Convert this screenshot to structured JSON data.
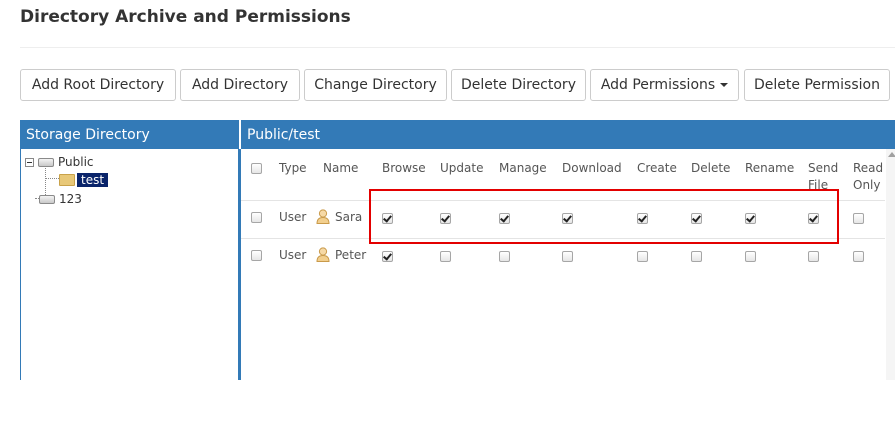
{
  "page": {
    "title": "Directory Archive and Permissions"
  },
  "toolbar": {
    "buttons": [
      {
        "label": "Add Root Directory"
      },
      {
        "label": "Add Directory"
      },
      {
        "label": "Change Directory"
      },
      {
        "label": "Delete Directory"
      },
      {
        "label": "Add Permissions",
        "has_caret": true
      },
      {
        "label": "Delete Permission"
      }
    ]
  },
  "storage": {
    "header": "Storage Directory",
    "tree": [
      {
        "label": "Public",
        "icon": "drive-icon",
        "expanded": true
      },
      {
        "label": "test",
        "icon": "folder-icon",
        "selected": true
      },
      {
        "label": "123",
        "icon": "drive-icon"
      }
    ]
  },
  "permissions": {
    "header": "Public/test",
    "columns": [
      "Type",
      "Name",
      "Browse",
      "Update",
      "Manage",
      "Download",
      "Create",
      "Delete",
      "Rename",
      "Send\nFile",
      "Read\nOnly"
    ],
    "rows": [
      {
        "type": "User",
        "name": "Sara",
        "icon": "user-icon",
        "flags": [
          true,
          true,
          true,
          true,
          true,
          true,
          true,
          true,
          false
        ]
      },
      {
        "type": "User",
        "name": "Peter",
        "icon": "user-icon",
        "flags": [
          true,
          false,
          false,
          false,
          false,
          false,
          false,
          false,
          false
        ]
      }
    ]
  },
  "colors": {
    "panel_header": "#337ab7",
    "highlight": "#e30000",
    "selection": "#0a246a"
  }
}
